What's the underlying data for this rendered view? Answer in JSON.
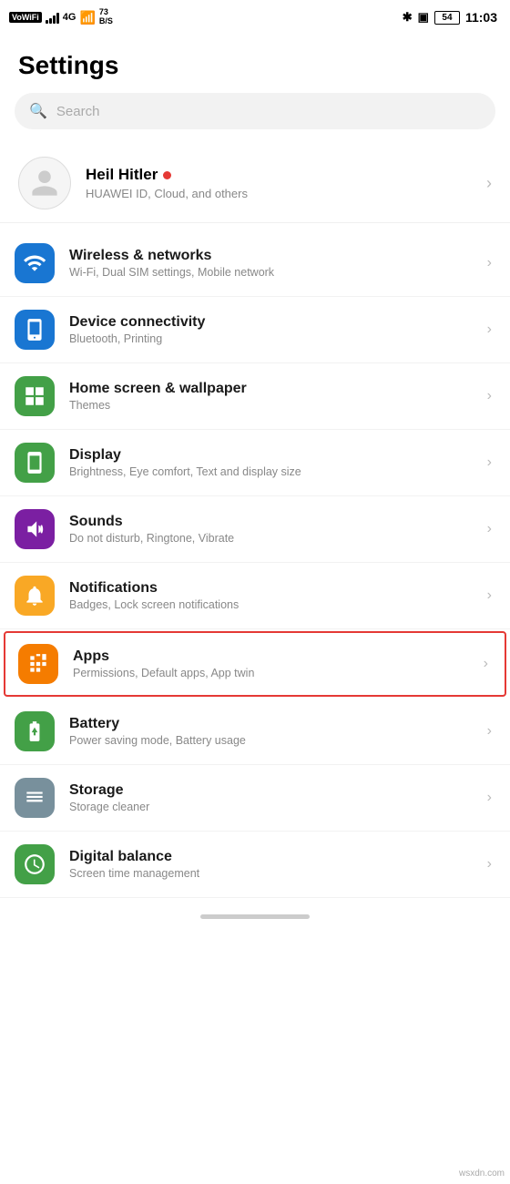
{
  "statusBar": {
    "left": {
      "vowifi": "VoWiFi",
      "signal": "4G",
      "wifi": "WiFi",
      "speed": "73\nB/S"
    },
    "right": {
      "bluetooth": "⚡",
      "battery": "54",
      "time": "11:03"
    }
  },
  "pageTitle": "Settings",
  "search": {
    "placeholder": "Search"
  },
  "profile": {
    "name": "Heil Hitler",
    "subtext": "HUAWEI ID, Cloud, and others"
  },
  "settingsItems": [
    {
      "id": "wireless",
      "title": "Wireless & networks",
      "subtitle": "Wi-Fi, Dual SIM settings, Mobile network",
      "iconColor": "#1976d2",
      "highlighted": false
    },
    {
      "id": "device-connectivity",
      "title": "Device connectivity",
      "subtitle": "Bluetooth, Printing",
      "iconColor": "#1976d2",
      "highlighted": false
    },
    {
      "id": "home-screen",
      "title": "Home screen & wallpaper",
      "subtitle": "Themes",
      "iconColor": "#43a047",
      "highlighted": false
    },
    {
      "id": "display",
      "title": "Display",
      "subtitle": "Brightness, Eye comfort, Text and display size",
      "iconColor": "#43a047",
      "highlighted": false
    },
    {
      "id": "sounds",
      "title": "Sounds",
      "subtitle": "Do not disturb, Ringtone, Vibrate",
      "iconColor": "#7b1fa2",
      "highlighted": false
    },
    {
      "id": "notifications",
      "title": "Notifications",
      "subtitle": "Badges, Lock screen notifications",
      "iconColor": "#f9a825",
      "highlighted": false
    },
    {
      "id": "apps",
      "title": "Apps",
      "subtitle": "Permissions, Default apps, App twin",
      "iconColor": "#f57c00",
      "highlighted": true
    },
    {
      "id": "battery",
      "title": "Battery",
      "subtitle": "Power saving mode, Battery usage",
      "iconColor": "#43a047",
      "highlighted": false
    },
    {
      "id": "storage",
      "title": "Storage",
      "subtitle": "Storage cleaner",
      "iconColor": "#78909c",
      "highlighted": false
    },
    {
      "id": "digital-balance",
      "title": "Digital balance",
      "subtitle": "Screen time management",
      "iconColor": "#43a047",
      "highlighted": false
    }
  ],
  "watermark": "wsxdn.com"
}
